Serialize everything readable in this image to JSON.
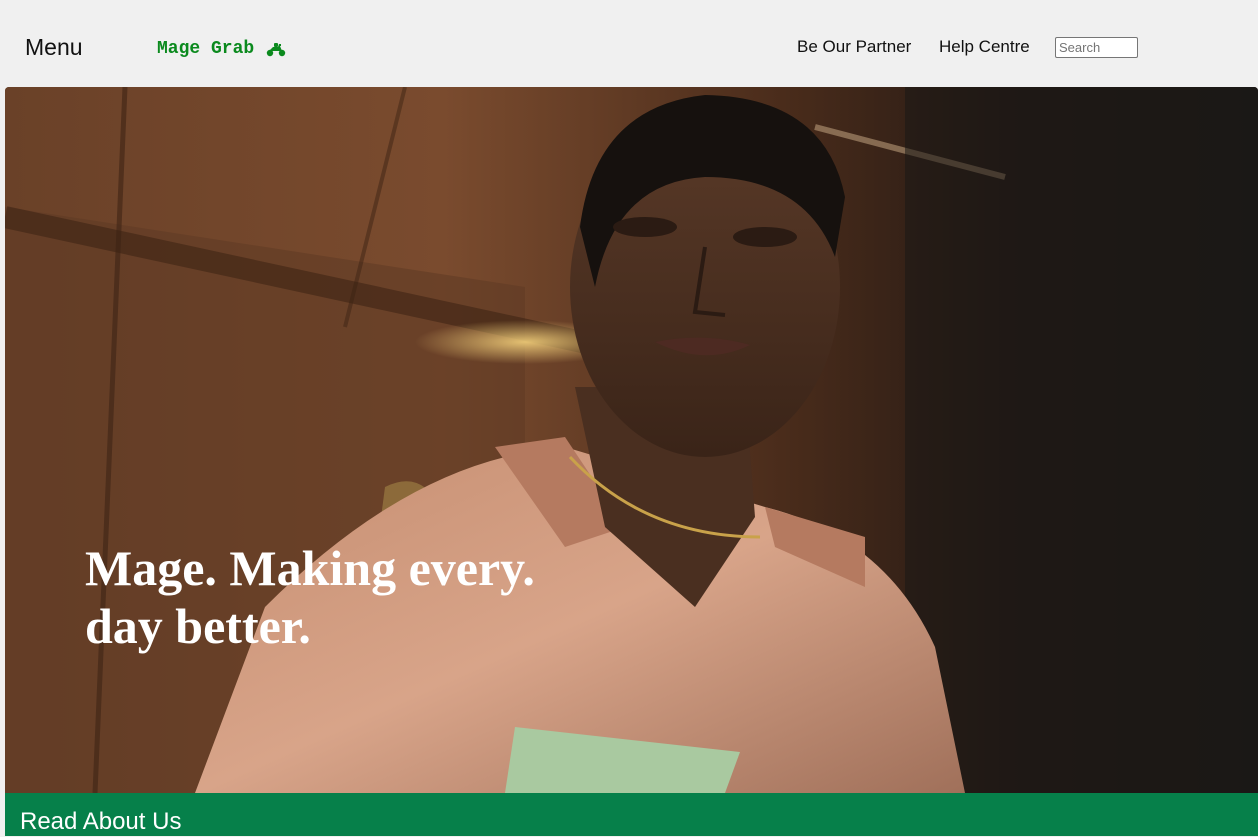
{
  "header": {
    "menu_label": "Menu",
    "brand_name": "Mage Grab",
    "brand_icon": "scooter-icon",
    "nav": {
      "partner_label": "Be Our Partner",
      "help_label": "Help Centre"
    },
    "search": {
      "placeholder": "Search",
      "value": ""
    }
  },
  "hero": {
    "headline": "Mage. Making every. day better."
  },
  "about": {
    "label": "Read About Us"
  },
  "colors": {
    "brand_green": "#0b8a1e",
    "about_bar": "#06804a",
    "header_bg": "#f0f0f0"
  }
}
